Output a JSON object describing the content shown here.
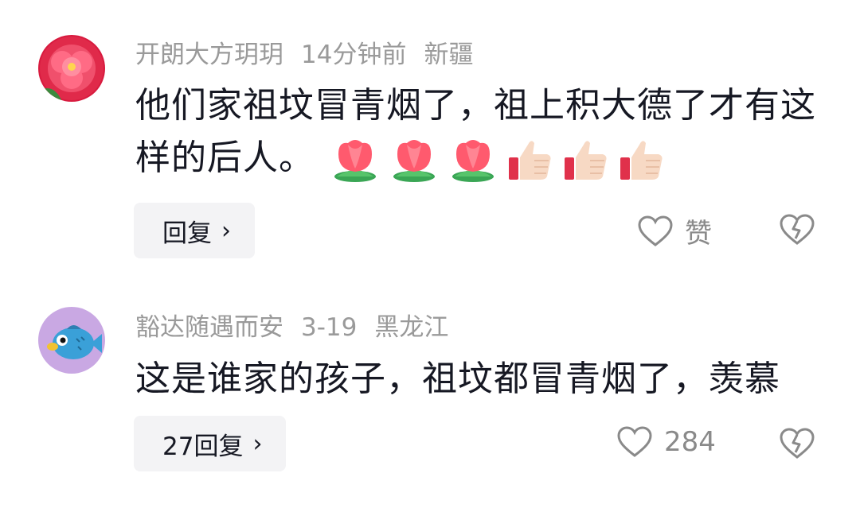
{
  "comments": [
    {
      "username": "开朗大方玥玥",
      "time": "14分钟前",
      "location": "新疆",
      "text": "他们家祖坟冒青烟了，祖上积大德了才有这样的后人。",
      "emojis": [
        "tulip-emoji",
        "tulip-emoji",
        "tulip-emoji",
        "thumbs-up-emoji",
        "thumbs-up-emoji",
        "thumbs-up-emoji"
      ],
      "reply_label": "回复",
      "like_label": "赞"
    },
    {
      "username": "豁达随遇而安",
      "time": "3-19",
      "location": "黑龙江",
      "text": "这是谁家的孩子，祖坟都冒青烟了，羡慕",
      "reply_label": "27回复",
      "like_label": "284"
    }
  ],
  "colors": {
    "meta_text": "#9a9a9a",
    "body_text": "#161823",
    "icon_gray": "#8a8a8a",
    "reply_bg": "#f3f3f5"
  }
}
